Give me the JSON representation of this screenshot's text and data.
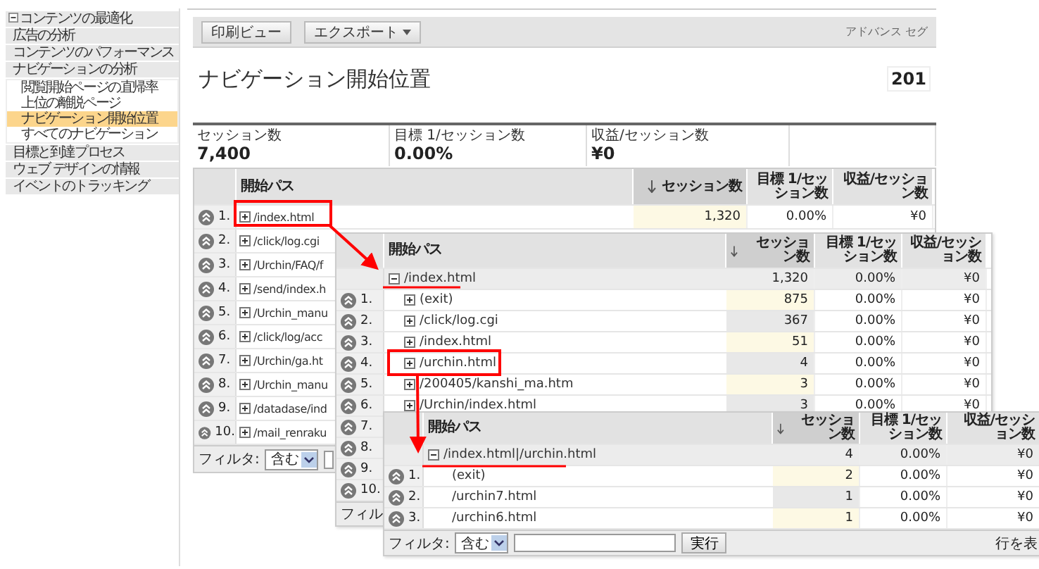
{
  "sidebar": {
    "items": [
      {
        "label": "コンテンツの最適化",
        "expanded": true,
        "selected": false,
        "children": [
          {
            "label": "広告の分析",
            "selected": false
          },
          {
            "label": "コンテンツのパフォーマンス",
            "selected": false
          },
          {
            "label": "ナビゲーションの分析",
            "selected": false,
            "children": [
              {
                "label": "閲覧開始ページの直帰率",
                "selected": false
              },
              {
                "label": "上位の離脱ページ",
                "selected": false
              },
              {
                "label": "ナビゲーション開始位置",
                "selected": true
              },
              {
                "label": "すべてのナビゲーション",
                "selected": false
              }
            ]
          },
          {
            "label": "目標と到達プロセス",
            "selected": false
          },
          {
            "label": "ウェブ デザインの情報",
            "selected": false
          },
          {
            "label": "イベントのトラッキング",
            "selected": false
          }
        ]
      }
    ]
  },
  "toolbar": {
    "buttons": [
      {
        "label": "印刷ビュー",
        "dropdown": false
      },
      {
        "label": "エクスポート",
        "dropdown": true
      }
    ],
    "segment_label": "アドバンス セグ"
  },
  "page_title": "ナビゲーション開始位置",
  "date_range": "201",
  "summary": [
    {
      "label": "セッション数",
      "value": "7,400"
    },
    {
      "label": "目標 1/セッション数",
      "value": "0.00%"
    },
    {
      "label": "収益/セッション数",
      "value": "¥0"
    }
  ],
  "tables": [
    {
      "columns": [
        "開始パス",
        "セッション数",
        "目標 1/セッション数",
        "収益/セッション数"
      ],
      "rows": [
        {
          "rank": "1.",
          "path": "/index.html",
          "expanded": false,
          "sessions": "1,320",
          "goal": "0.00%",
          "revenue": "¥0"
        },
        {
          "rank": "2.",
          "path": "/click/log.cgi",
          "expanded": false
        },
        {
          "rank": "3.",
          "path": "/Urchin/FAQ/f",
          "expanded": false
        },
        {
          "rank": "4.",
          "path": "/send/index.h",
          "expanded": false
        },
        {
          "rank": "5.",
          "path": "/Urchin_manu",
          "expanded": false
        },
        {
          "rank": "6.",
          "path": "/click/log/acc",
          "expanded": false
        },
        {
          "rank": "7.",
          "path": "/Urchin/ga.ht",
          "expanded": false
        },
        {
          "rank": "8.",
          "path": "/Urchin_manu",
          "expanded": false
        },
        {
          "rank": "9.",
          "path": "/datadase/ind",
          "expanded": false
        },
        {
          "rank": "10.",
          "path": "/mail_renraku",
          "expanded": false
        }
      ],
      "filter": {
        "label": "フィルタ:",
        "operator": "含む"
      }
    },
    {
      "columns": [
        "開始パス",
        "セッション数",
        "目標 1/セッション数",
        "収益/セッション数"
      ],
      "parent": {
        "path": "/index.html",
        "expanded": true,
        "sessions": "1,320",
        "goal": "0.00%",
        "revenue": "¥0"
      },
      "rows": [
        {
          "rank": "1.",
          "path": "(exit)",
          "expanded": false,
          "sessions": "875",
          "goal": "0.00%",
          "revenue": "¥0"
        },
        {
          "rank": "2.",
          "path": "/click/log.cgi",
          "expanded": false,
          "sessions": "367",
          "goal": "0.00%",
          "revenue": "¥0"
        },
        {
          "rank": "3.",
          "path": "/index.html",
          "expanded": false,
          "sessions": "51",
          "goal": "0.00%",
          "revenue": "¥0"
        },
        {
          "rank": "4.",
          "path": "/urchin.html",
          "expanded": false,
          "sessions": "4",
          "goal": "0.00%",
          "revenue": "¥0"
        },
        {
          "rank": "5.",
          "path": "/200405/kanshi_ma.htm",
          "expanded": false,
          "sessions": "3",
          "goal": "0.00%",
          "revenue": "¥0"
        },
        {
          "rank": "6.",
          "path": "/Urchin/index.html",
          "expanded": false,
          "sessions": "3",
          "goal": "0.00%",
          "revenue": "¥0"
        },
        {
          "rank": "7."
        },
        {
          "rank": "8."
        },
        {
          "rank": "9."
        },
        {
          "rank": "10."
        }
      ],
      "filter": {
        "label": "フィル"
      }
    },
    {
      "columns": [
        "開始パス",
        "セッション数",
        "目標 1/セッション数",
        "収益/セッション数"
      ],
      "parent": {
        "path": "/index.html|/urchin.html",
        "expanded": true,
        "sessions": "4",
        "goal": "0.00%",
        "revenue": "¥0"
      },
      "rows": [
        {
          "rank": "1.",
          "path": "(exit)",
          "sessions": "2",
          "goal": "0.00%",
          "revenue": "¥0"
        },
        {
          "rank": "2.",
          "path": "/urchin7.html",
          "sessions": "1",
          "goal": "0.00%",
          "revenue": "¥0"
        },
        {
          "rank": "3.",
          "path": "/urchin6.html",
          "sessions": "1",
          "goal": "0.00%",
          "revenue": "¥0"
        }
      ],
      "filter": {
        "label": "フィルタ:",
        "operator": "含む",
        "button": "実行",
        "rows_label": "行を表"
      }
    }
  ]
}
